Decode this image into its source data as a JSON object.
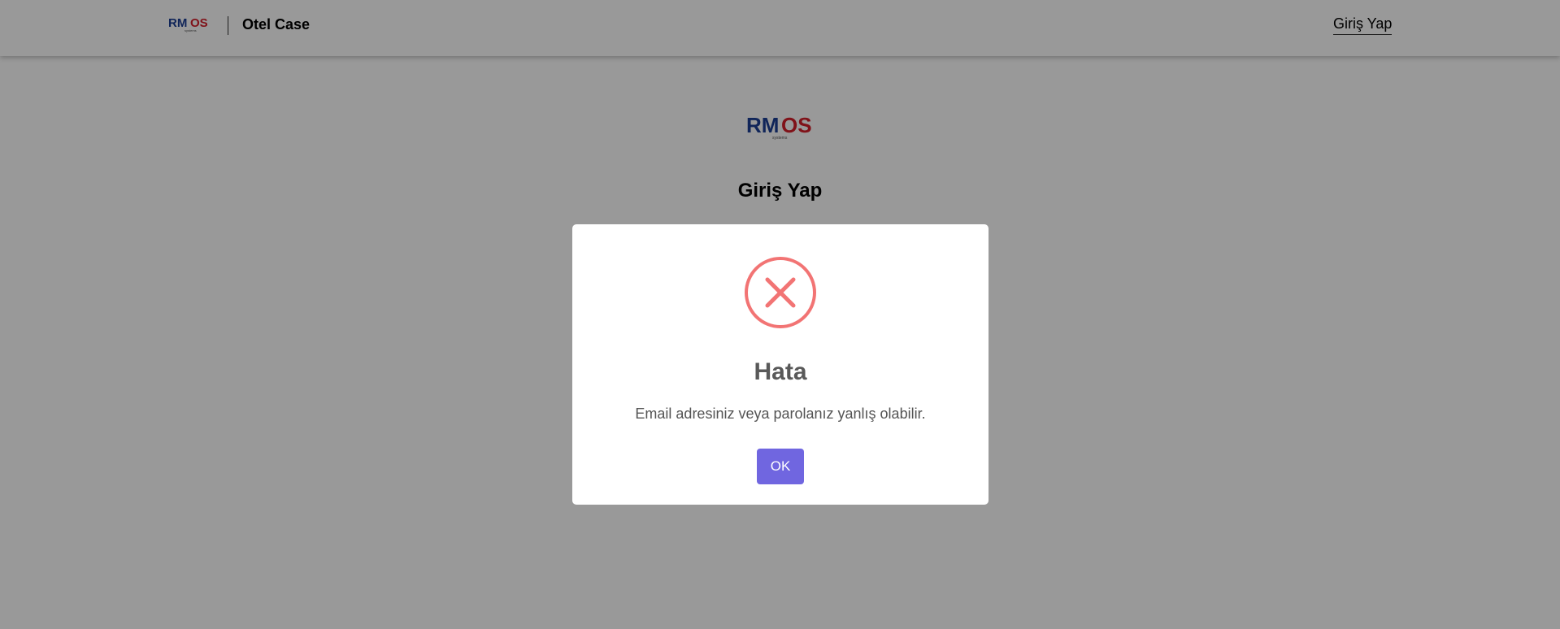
{
  "header": {
    "logo": {
      "text_main": "RMOS",
      "text_sub": "systems"
    },
    "brand": "Otel Case",
    "login_link": "Giriş Yap"
  },
  "main": {
    "logo": {
      "text_main": "RMOS",
      "text_sub": "systems"
    },
    "title": "Giriş Yap"
  },
  "dialog": {
    "icon": "error-x-icon",
    "title": "Hata",
    "message": "Email adresiniz veya parolanız yanlış olabilir.",
    "confirm_label": "OK"
  },
  "colors": {
    "logo_blue": "#1c3f94",
    "logo_red": "#d51f2b",
    "error_red": "#f27474",
    "confirm_button": "#7066e0",
    "overlay": "rgba(0,0,0,0.4)"
  }
}
